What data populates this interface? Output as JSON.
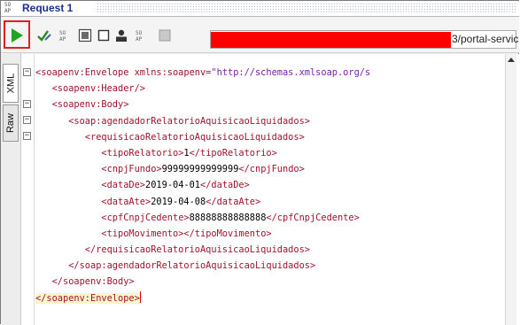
{
  "window": {
    "icon_text_top": "SO",
    "icon_text_bottom": "AP",
    "title": "Request 1"
  },
  "toolbar": {
    "buttons": [
      {
        "name": "submit-request-button",
        "icon": "play-icon"
      },
      {
        "name": "validate-button",
        "icon": "checkmark-icon"
      },
      {
        "name": "format-xml-button",
        "icon": "soap-format-icon"
      },
      {
        "name": "maximize-editor-button",
        "icon": "window-icon"
      },
      {
        "name": "split-view-button",
        "icon": "square-icon"
      },
      {
        "name": "auth-button",
        "icon": "user-icon"
      },
      {
        "name": "wsa-button",
        "icon": "soap-badge-icon"
      },
      {
        "name": "options-button",
        "icon": "grey-box-icon"
      }
    ],
    "endpoint_visible_text": "3/portal-servic"
  },
  "sidetabs": {
    "xml_label": "XML",
    "raw_label": "Raw"
  },
  "xml": {
    "lines": [
      {
        "indent": "",
        "open": "<soapenv:Envelope",
        "attr": " xmlns:soapenv=",
        "value": "\"http://schemas.xmlsoap.org/s",
        "close": ""
      },
      {
        "indent": "   ",
        "open": "<soapenv:Header/>",
        "attr": "",
        "value": "",
        "close": ""
      },
      {
        "indent": "   ",
        "open": "<soapenv:Body>",
        "attr": "",
        "value": "",
        "close": ""
      },
      {
        "indent": "      ",
        "open": "<soap:agendadorRelatorioAquisicaoLiquidados>",
        "attr": "",
        "value": "",
        "close": ""
      },
      {
        "indent": "         ",
        "open": "<requisicaoRelatorioAquisicaoLiquidados>",
        "attr": "",
        "value": "",
        "close": ""
      },
      {
        "indent": "            ",
        "open": "<tipoRelatorio>",
        "attr": "",
        "value": "1",
        "close": "</tipoRelatorio>"
      },
      {
        "indent": "            ",
        "open": "<cnpjFundo>",
        "attr": "",
        "value": "99999999999999",
        "close": "</cnpjFundo>"
      },
      {
        "indent": "            ",
        "open": "<dataDe>",
        "attr": "",
        "value": "2019-04-01",
        "close": "</dataDe>"
      },
      {
        "indent": "            ",
        "open": "<dataAte>",
        "attr": "",
        "value": "2019-04-08",
        "close": "</dataAte>"
      },
      {
        "indent": "            ",
        "open": "<cpfCnpjCedente>",
        "attr": "",
        "value": "88888888888888",
        "close": "</cpfCnpjCedente>"
      },
      {
        "indent": "            ",
        "open": "<tipoMovimento>",
        "attr": "",
        "value": "",
        "close": "</tipoMovimento>"
      },
      {
        "indent": "         ",
        "open": "</requisicaoRelatorioAquisicaoLiquidados>",
        "attr": "",
        "value": "",
        "close": ""
      },
      {
        "indent": "      ",
        "open": "</soap:agendadorRelatorioAquisicaoLiquidados>",
        "attr": "",
        "value": "",
        "close": ""
      },
      {
        "indent": "   ",
        "open": "</soapenv:Body>",
        "attr": "",
        "value": "",
        "close": ""
      },
      {
        "indent": "",
        "open": "</soapenv:Envelope>",
        "attr": "",
        "value": "",
        "close": ""
      }
    ]
  },
  "colors": {
    "tag": "#a0142c",
    "string": "#7a1fa8",
    "title": "#1c2f8f",
    "highlight": "#e02020",
    "redaction": "#ff0000"
  }
}
